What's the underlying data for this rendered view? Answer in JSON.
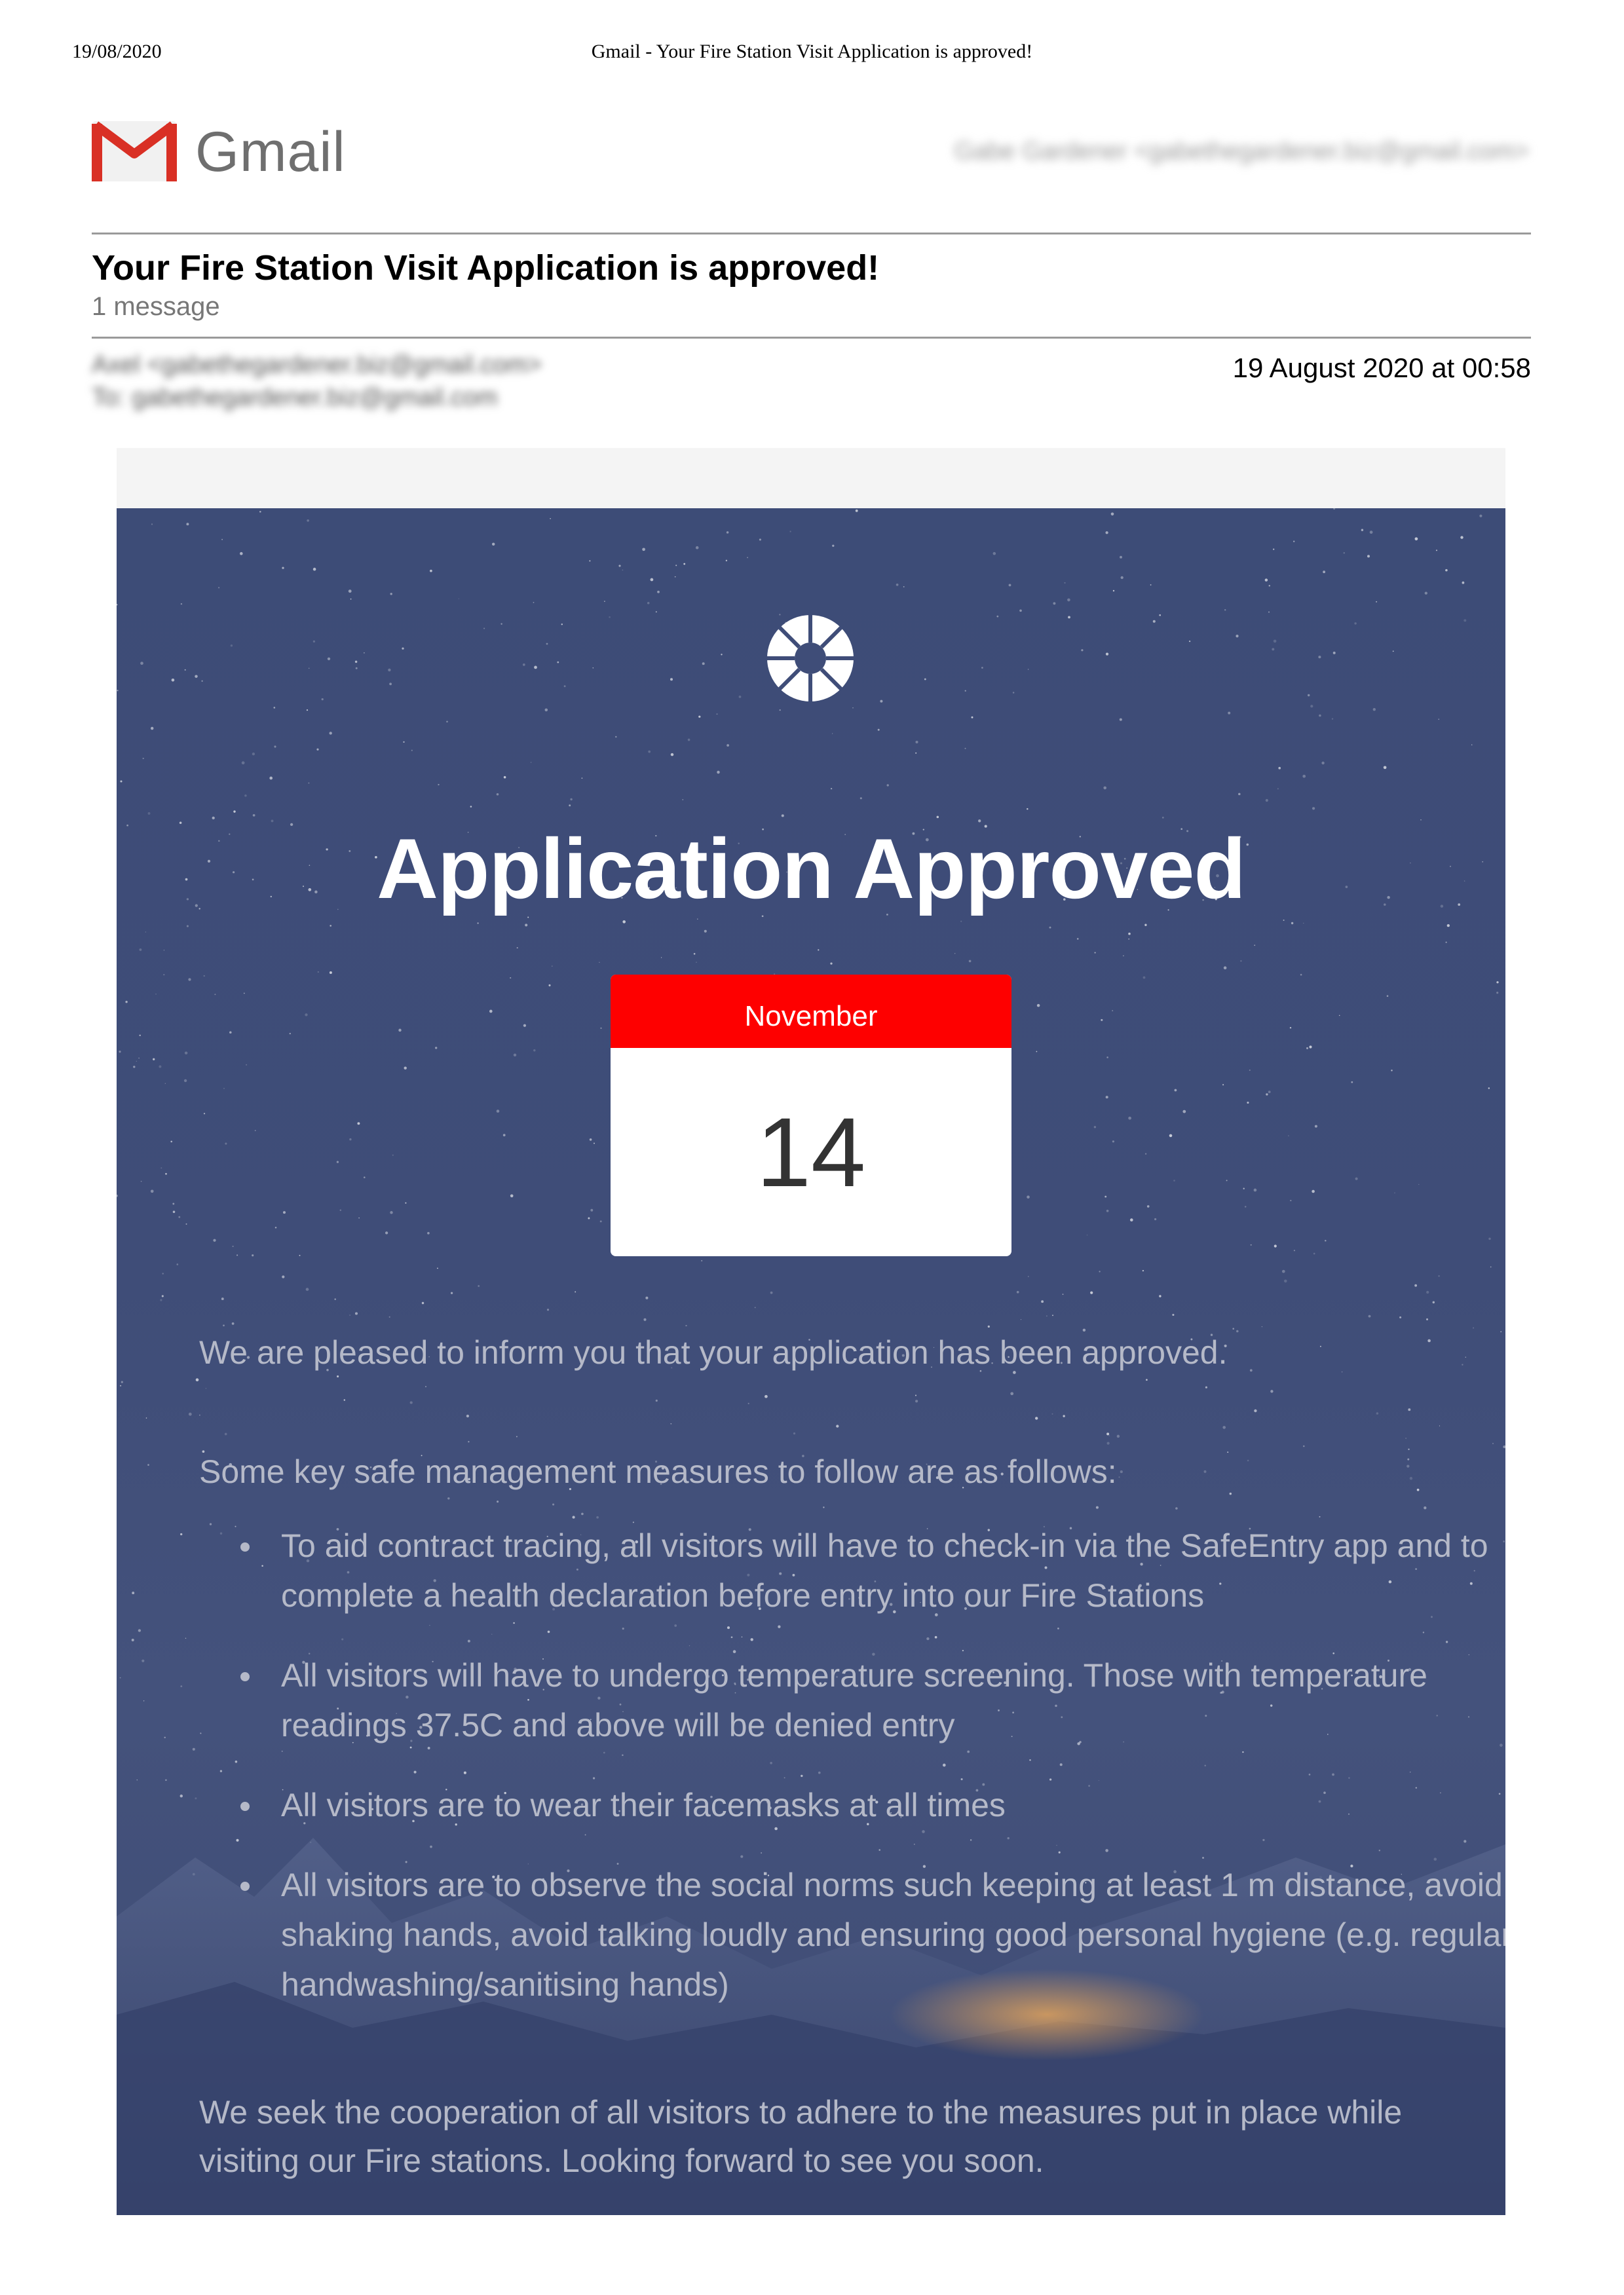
{
  "print_header": {
    "date": "19/08/2020",
    "title": "Gmail - Your Fire Station Visit Application is approved!"
  },
  "header": {
    "logo_text": "Gmail",
    "account": "Gabe Gardener <gabethegardener.biz@gmail.com>"
  },
  "thread": {
    "subject": "Your Fire Station Visit Application is approved!",
    "count": "1 message"
  },
  "message": {
    "from": "Axel <gabethegardener.biz@gmail.com>",
    "to": "To: gabethegardener.biz@gmail.com",
    "date": "19 August 2020 at 00:58"
  },
  "email": {
    "headline": "Application Approved",
    "calendar": {
      "month": "November",
      "day": "14"
    },
    "intro": "We are pleased to inform you that your application has been approved.",
    "measures_intro": "Some key safe management measures to follow are as follows:",
    "measures": [
      "To aid contract tracing, all visitors will have to check-in via the SafeEntry app and to complete a health declaration before entry into our Fire Stations",
      " All visitors will have to undergo temperature screening. Those with temperature readings 37.5C and above will be denied entry",
      "All visitors are to wear their facemasks at all times",
      "All visitors are to observe the social norms such keeping at least 1 m distance, avoid shaking hands, avoid talking loudly and ensuring good personal hygiene (e.g. regular handwashing/sanitising hands)"
    ],
    "closing": "We seek the cooperation of all visitors to adhere to the measures put in place while visiting our Fire stations. Looking forward to see you soon."
  },
  "colors": {
    "gmail_red": "#d93025",
    "hero_blue": "#3f4d78",
    "calendar_red": "#fe0000",
    "body_text": "#b5b9c8"
  }
}
